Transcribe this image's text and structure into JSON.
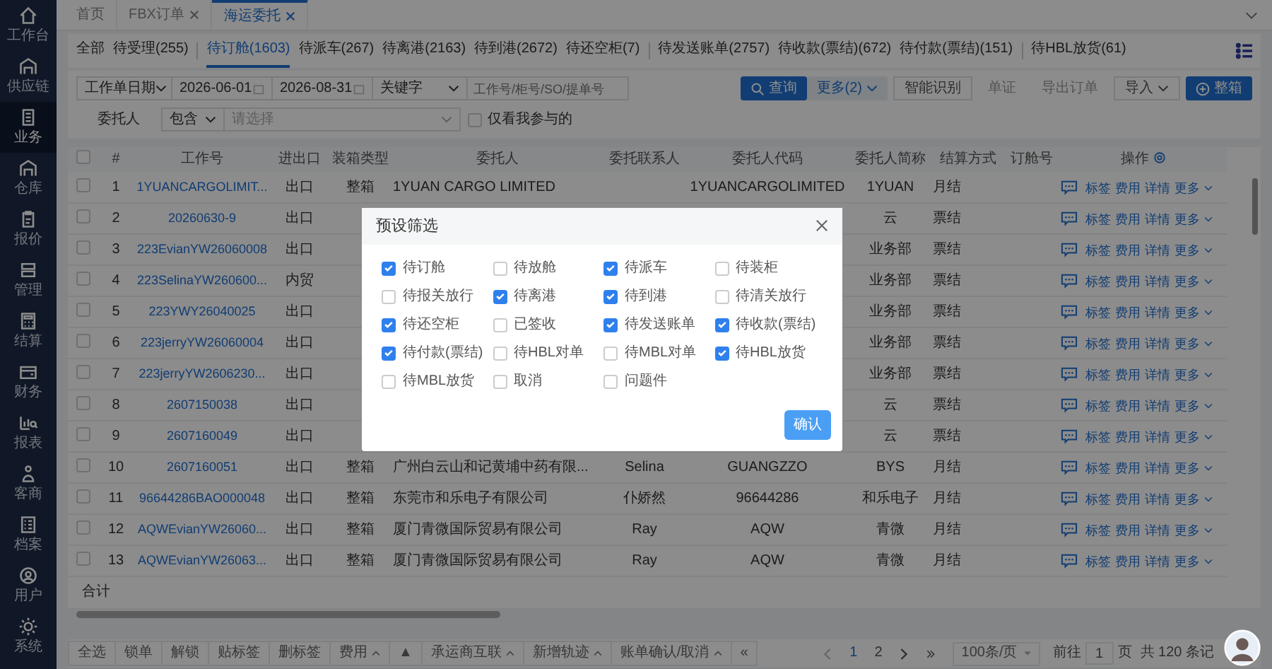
{
  "sidebar": {
    "items": [
      {
        "label": "工作台",
        "selected": false
      },
      {
        "label": "供应链",
        "selected": false
      },
      {
        "label": "业务",
        "selected": true
      },
      {
        "label": "仓库",
        "selected": false
      },
      {
        "label": "报价",
        "selected": false
      },
      {
        "label": "管理",
        "selected": false
      },
      {
        "label": "结算",
        "selected": false
      },
      {
        "label": "财务",
        "selected": false
      },
      {
        "label": "报表",
        "selected": false
      },
      {
        "label": "客商",
        "selected": false
      },
      {
        "label": "档案",
        "selected": false
      },
      {
        "label": "用户",
        "selected": false
      },
      {
        "label": "系统",
        "selected": false
      }
    ]
  },
  "page_tabs": [
    {
      "label": "首页",
      "closable": false,
      "selected": false
    },
    {
      "label": "FBX订单",
      "closable": true,
      "selected": false
    },
    {
      "label": "海运委托",
      "closable": true,
      "selected": true
    }
  ],
  "status_tab_groups": [
    [
      {
        "label": "全部",
        "selected": false
      },
      {
        "label": "待受理(255)",
        "selected": false
      }
    ],
    [
      {
        "label": "待订舱(1603)",
        "selected": true
      },
      {
        "label": "待派车(267)",
        "selected": false
      },
      {
        "label": "待离港(2163)",
        "selected": false
      },
      {
        "label": "待到港(2672)",
        "selected": false
      },
      {
        "label": "待还空柜(7)",
        "selected": false
      }
    ],
    [
      {
        "label": "待发送账单(2757)",
        "selected": false
      },
      {
        "label": "待收款(票结)(672)",
        "selected": false
      },
      {
        "label": "待付款(票结)(151)",
        "selected": false
      }
    ],
    [
      {
        "label": "待HBL放货(61)",
        "selected": false
      }
    ]
  ],
  "filters": {
    "date_field": "工作单日期",
    "date_from": "2026-06-01",
    "date_to": "2026-08-31",
    "keyword_field": "关键字",
    "keyword_placeholder": "工作号/柜号/SO/提单号",
    "client_label": "委托人",
    "client_match": "包含",
    "client_placeholder": "请选择",
    "only_mine": {
      "label": "仅看我参与的",
      "checked": false
    }
  },
  "actions": [
    {
      "label": "查询",
      "kind": "search"
    },
    {
      "label": "更多(2)",
      "kind": "more"
    },
    {
      "label": "智能识别",
      "kind": "outline"
    },
    {
      "label": "单证",
      "kind": "plain"
    },
    {
      "label": "导出订单",
      "kind": "plain"
    },
    {
      "label": "导入",
      "kind": "dropdown"
    },
    {
      "label": "整箱",
      "kind": "add"
    }
  ],
  "table": {
    "select_all": false,
    "columns": [
      "#",
      "工作号",
      "进出口",
      "装箱类型",
      "委托人",
      "委托联系人",
      "委托人代码",
      "委托人简称",
      "结算方式",
      "订舱号",
      "操作"
    ],
    "rows": [
      {
        "selected": false,
        "index": "1",
        "job_no": "1YUANCARGOLIMIT...",
        "direction": "出口",
        "container": "整箱",
        "client": "1YUAN CARGO LIMITED",
        "client_code": "1YUANCARGOLIMITED",
        "short_name": "1YUAN",
        "settlement": "月结",
        "actions": [
          "标签",
          "费用",
          "详情",
          "更多"
        ]
      },
      {
        "selected": false,
        "index": "2",
        "job_no": "20260630-9",
        "direction": "出口",
        "short_name": "云",
        "settlement": "票结",
        "actions": [
          "标签",
          "费用",
          "详情",
          "更多"
        ]
      },
      {
        "selected": false,
        "index": "3",
        "job_no": "223EvianYW26060008",
        "direction": "出口",
        "short_name": "业务部",
        "settlement": "票结",
        "actions": [
          "标签",
          "费用",
          "详情",
          "更多"
        ]
      },
      {
        "selected": false,
        "index": "4",
        "job_no": "223SelinaYW260600...",
        "direction": "内贸",
        "short_name": "业务部",
        "settlement": "票结",
        "actions": [
          "标签",
          "费用",
          "详情",
          "更多"
        ]
      },
      {
        "selected": false,
        "index": "5",
        "job_no": "223YWY26040025",
        "direction": "出口",
        "short_name": "业务部",
        "settlement": "票结",
        "actions": [
          "标签",
          "费用",
          "详情",
          "更多"
        ]
      },
      {
        "selected": false,
        "index": "6",
        "job_no": "223jerryYW26060004",
        "direction": "出口",
        "short_name": "业务部",
        "settlement": "票结",
        "actions": [
          "标签",
          "费用",
          "详情",
          "更多"
        ]
      },
      {
        "selected": false,
        "index": "7",
        "job_no": "223jerryYW2606230...",
        "direction": "出口",
        "short_name": "业务部",
        "settlement": "票结",
        "actions": [
          "标签",
          "费用",
          "详情",
          "更多"
        ]
      },
      {
        "selected": false,
        "index": "8",
        "job_no": "2607150038",
        "direction": "出口",
        "short_name": "云",
        "settlement": "票结",
        "actions": [
          "标签",
          "费用",
          "详情",
          "更多"
        ]
      },
      {
        "selected": false,
        "index": "9",
        "job_no": "2607160049",
        "direction": "出口",
        "short_name": "云",
        "settlement": "票结",
        "actions": [
          "标签",
          "费用",
          "详情",
          "更多"
        ]
      },
      {
        "selected": false,
        "index": "10",
        "job_no": "2607160051",
        "direction": "出口",
        "container": "整箱",
        "client": "广州白云山和记黄埔中药有限...",
        "contact": "Selina",
        "client_code": "GUANGZZO",
        "short_name": "BYS",
        "settlement": "月结",
        "actions": [
          "标签",
          "费用",
          "详情",
          "更多"
        ]
      },
      {
        "selected": false,
        "index": "11",
        "job_no": "96644286BAO000048",
        "direction": "出口",
        "container": "整箱",
        "client": "东莞市和乐电子有限公司",
        "contact": "仆娇然",
        "client_code": "96644286",
        "short_name": "和乐电子",
        "settlement": "月结",
        "actions": [
          "标签",
          "费用",
          "详情",
          "更多"
        ]
      },
      {
        "selected": false,
        "index": "12",
        "job_no": "AQWEvianYW26060...",
        "direction": "出口",
        "container": "整箱",
        "client": "厦门青微国际贸易有限公司",
        "contact": "Ray",
        "client_code": "AQW",
        "short_name": "青微",
        "settlement": "月结",
        "actions": [
          "标签",
          "费用",
          "详情",
          "更多"
        ]
      },
      {
        "selected": false,
        "index": "13",
        "job_no": "AQWEvianYW26063...",
        "direction": "出口",
        "container": "整箱",
        "client": "厦门青微国际贸易有限公司",
        "contact": "Ray",
        "client_code": "AQW",
        "short_name": "青微",
        "settlement": "月结",
        "actions": [
          "标签",
          "费用",
          "详情",
          "更多"
        ]
      }
    ],
    "total_label": "合计"
  },
  "bottom_toolbar": [
    {
      "label": "全选",
      "menu": false
    },
    {
      "label": "锁单",
      "menu": false
    },
    {
      "label": "解锁",
      "menu": false
    },
    {
      "label": "贴标签",
      "menu": false
    },
    {
      "label": "删标签",
      "menu": false
    },
    {
      "label": "费用",
      "menu": true
    },
    {
      "label": "▲",
      "menu": false
    },
    {
      "label": "承运商互联",
      "menu": true
    },
    {
      "label": "新增轨迹",
      "menu": true
    },
    {
      "label": "账单确认/取消",
      "menu": true
    },
    {
      "label": "«",
      "menu": false
    }
  ],
  "pagination": {
    "pages": [
      {
        "label": "1",
        "selected": true
      },
      {
        "label": "2",
        "selected": false
      }
    ],
    "page_size": "100条/页",
    "goto_label": "前往",
    "goto_value": "1",
    "page_unit": "页",
    "total": "共 120 条记"
  },
  "modal": {
    "title": "预设筛选",
    "options": [
      {
        "label": "待订舱",
        "checked": true
      },
      {
        "label": "待放舱",
        "checked": false
      },
      {
        "label": "待派车",
        "checked": true
      },
      {
        "label": "待装柜",
        "checked": false
      },
      {
        "label": "待报关放行",
        "checked": false
      },
      {
        "label": "待离港",
        "checked": true
      },
      {
        "label": "待到港",
        "checked": true
      },
      {
        "label": "待清关放行",
        "checked": false
      },
      {
        "label": "待还空柜",
        "checked": true
      },
      {
        "label": "已签收",
        "checked": false
      },
      {
        "label": "待发送账单",
        "checked": true
      },
      {
        "label": "待收款(票结)",
        "checked": true
      },
      {
        "label": "待付款(票结)",
        "checked": true
      },
      {
        "label": "待HBL对单",
        "checked": false
      },
      {
        "label": "待MBL对单",
        "checked": false
      },
      {
        "label": "待HBL放货",
        "checked": true
      },
      {
        "label": "待MBL放货",
        "checked": false
      },
      {
        "label": "取消",
        "checked": false
      },
      {
        "label": "问题件",
        "checked": false
      }
    ],
    "confirm": "确认"
  }
}
